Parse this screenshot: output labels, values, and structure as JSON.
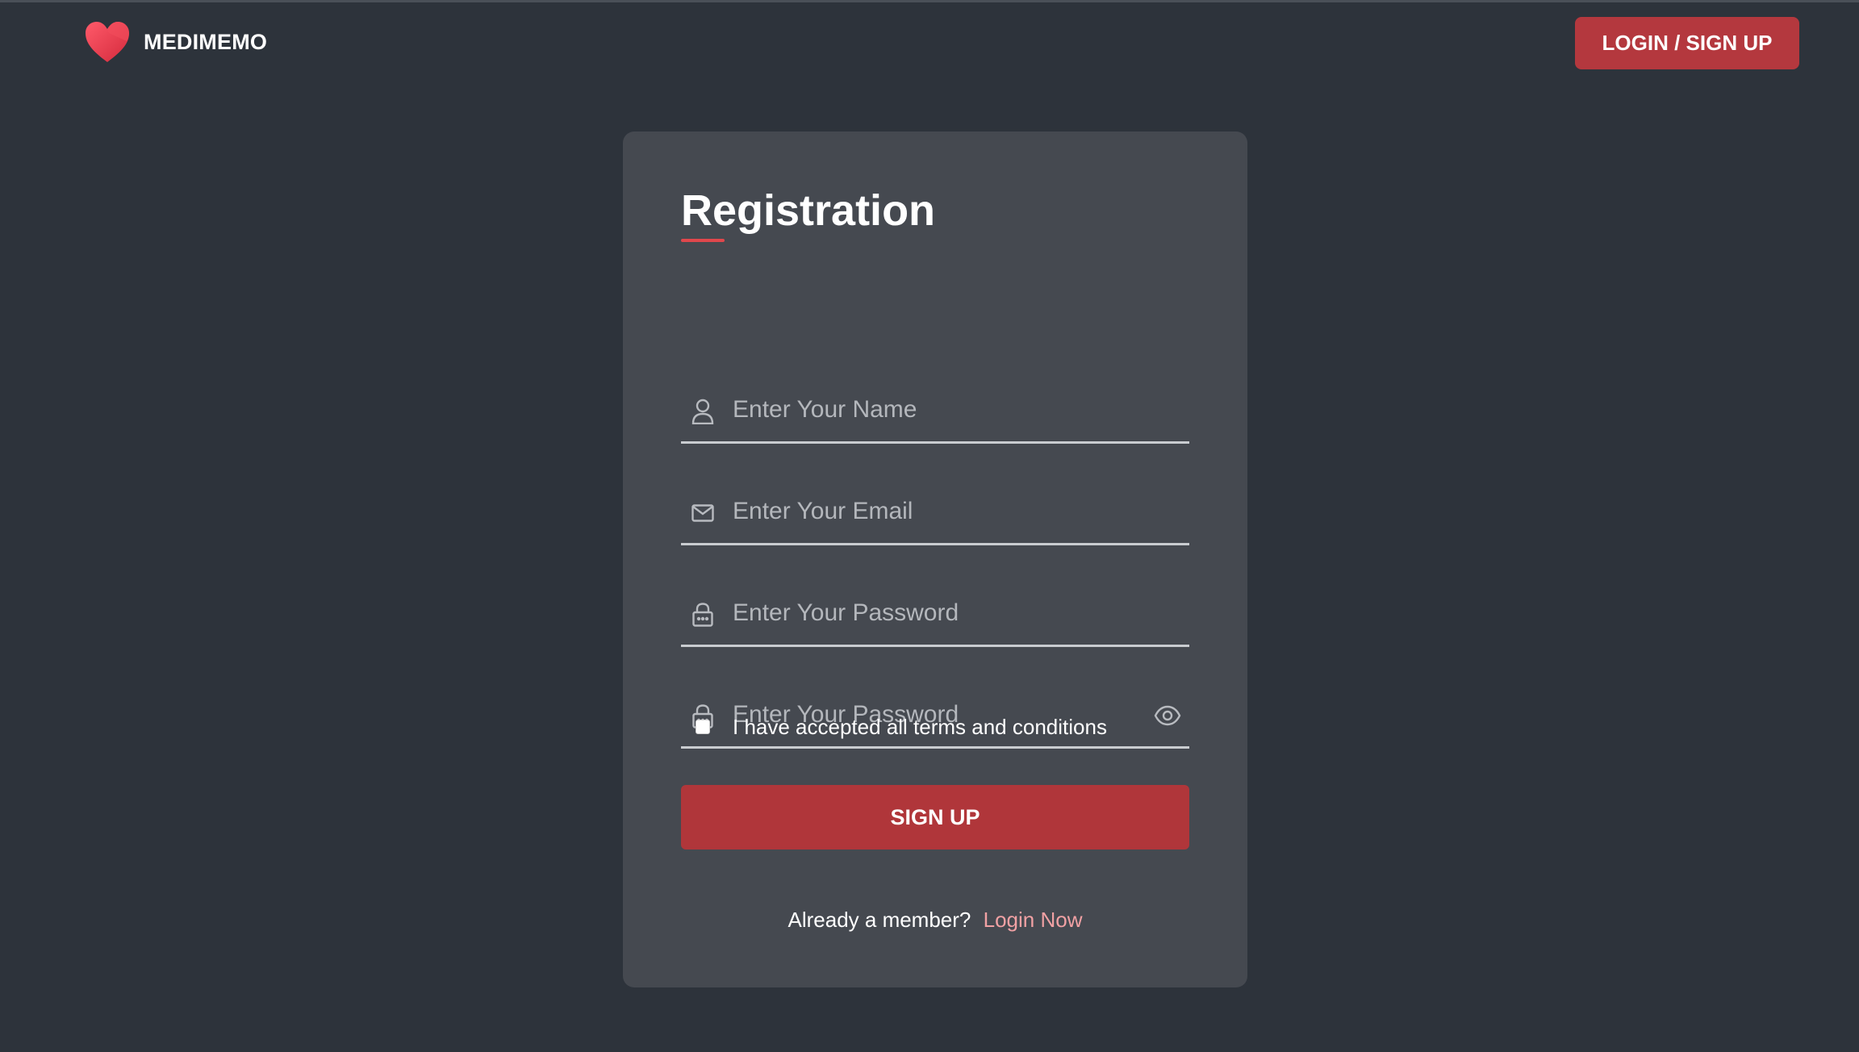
{
  "header": {
    "brand_name": "MEDIMEMO",
    "auth_button_label": "LOGIN / SIGN UP"
  },
  "form": {
    "title": "Registration",
    "fields": {
      "name": {
        "placeholder": "Enter Your Name",
        "value": "",
        "icon": "user-icon"
      },
      "email": {
        "placeholder": "Enter Your Email",
        "value": "",
        "icon": "mail-icon"
      },
      "password": {
        "placeholder": "Enter Your Password",
        "value": "",
        "icon": "lock-icon"
      },
      "confirm_password": {
        "placeholder": "Enter Your Password",
        "value": "",
        "icon": "lock-icon",
        "toggle_icon": "eye-icon"
      }
    },
    "terms": {
      "label": "I have accepted all terms and conditions",
      "checked": false
    },
    "submit_label": "SIGN UP",
    "footer_text": "Already a member?",
    "footer_link": "Login Now"
  },
  "colors": {
    "page_background": "#2d333b",
    "card_background": "#454950",
    "accent": "#b4383e",
    "title_underline": "#e0474c",
    "link": "#f1a1a4",
    "logo_heart": "#e8394a"
  }
}
